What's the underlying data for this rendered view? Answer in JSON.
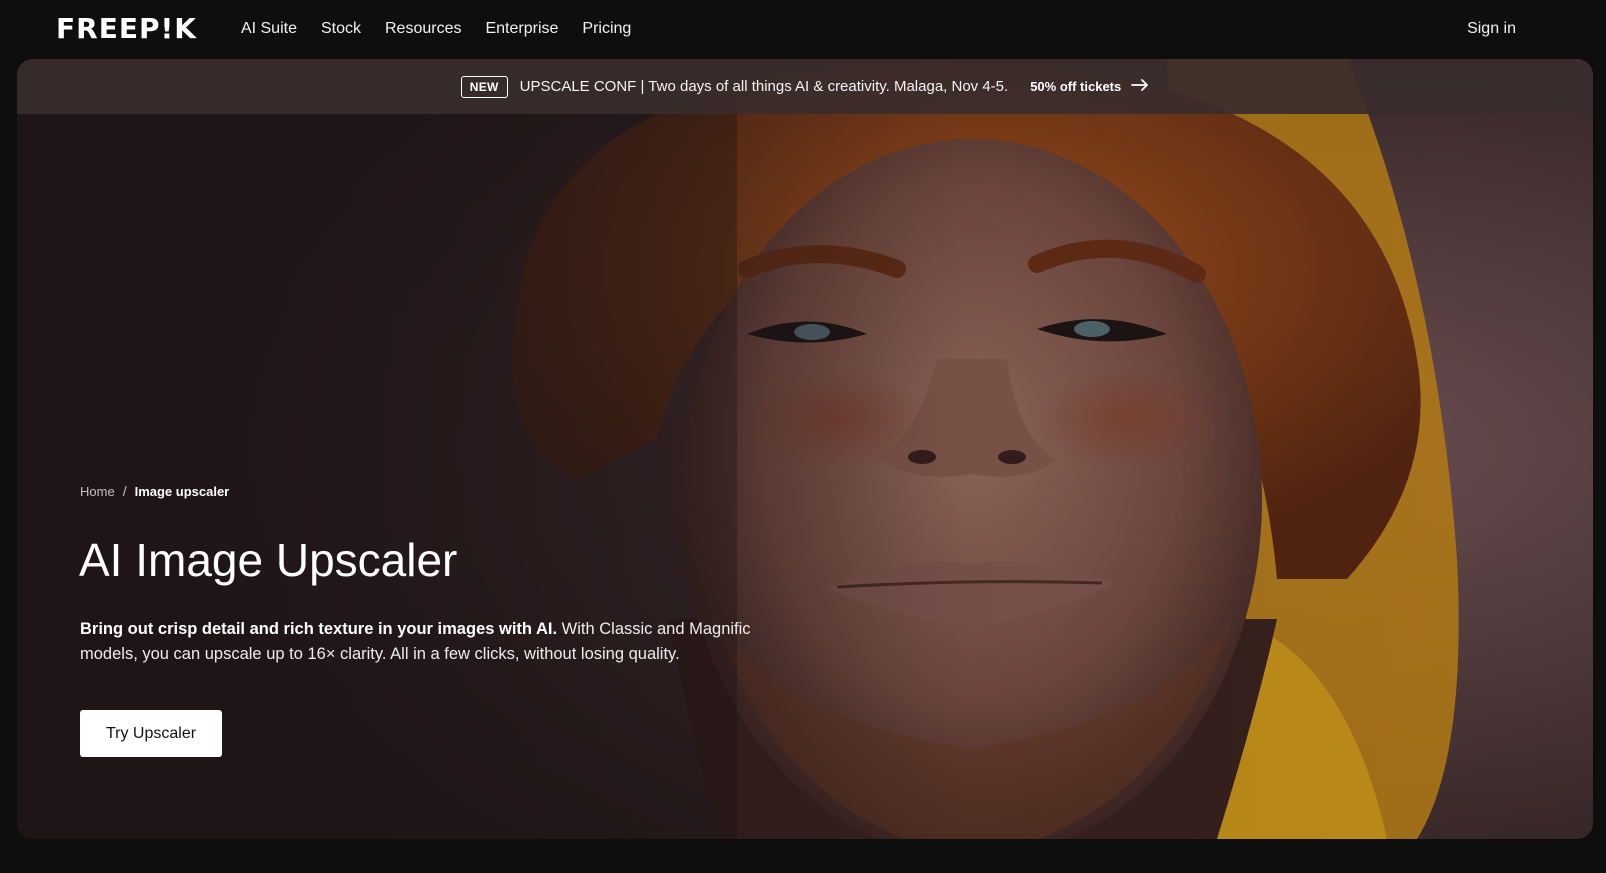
{
  "header": {
    "logo": "FREEP!K",
    "nav": [
      "AI Suite",
      "Stock",
      "Resources",
      "Enterprise",
      "Pricing"
    ],
    "signin_label": "Sign in"
  },
  "promo": {
    "badge": "NEW",
    "text": "UPSCALE CONF | Two days of all things AI & creativity. Malaga, Nov 4-5.",
    "link_label": "50% off tickets",
    "link_icon": "arrow-right-icon"
  },
  "hero": {
    "breadcrumb": {
      "home": "Home",
      "separator": "/",
      "current": "Image upscaler"
    },
    "title": "AI Image Upscaler",
    "description_bold": "Bring out crisp detail and rich texture in your images with AI.",
    "description_rest": " With Classic and Magnific models, you can upscale up to 16× clarity. All in a few clicks, without losing quality.",
    "cta_label": "Try Upscaler"
  },
  "colors": {
    "page_bg": "#0e0e0e",
    "hero_bg": "#2a1d1e",
    "promo_bg": "#3a2c2d",
    "hair": "#b5561f",
    "hat": "#d79a1c"
  }
}
